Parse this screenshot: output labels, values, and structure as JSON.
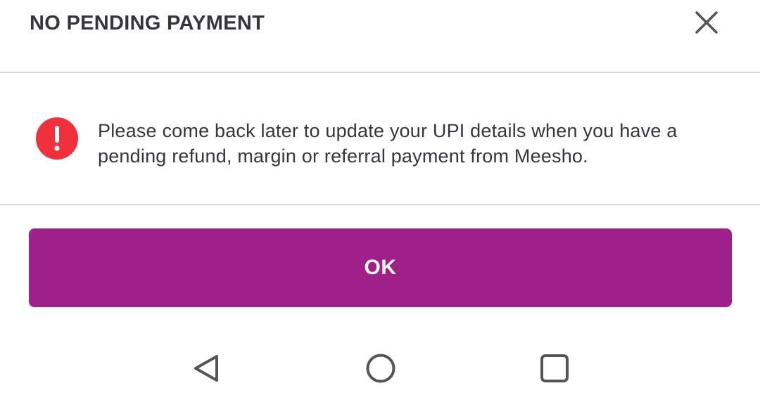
{
  "dialog": {
    "title": "NO PENDING PAYMENT",
    "close_icon": "close-icon",
    "message": "Please come back later to update your UPI details when you have a pending refund, margin or referral payment from Meesho.",
    "alert_icon": "exclamation-circle-icon",
    "ok_label": "OK"
  },
  "navigation_bar": {
    "back_icon": "back-triangle-icon",
    "home_icon": "home-circle-icon",
    "recents_icon": "recents-square-icon"
  },
  "colors": {
    "accent": "#9f2089",
    "alert": "#f0303c",
    "text": "#35363d",
    "divider": "#d6d6de",
    "icon": "#555555"
  }
}
